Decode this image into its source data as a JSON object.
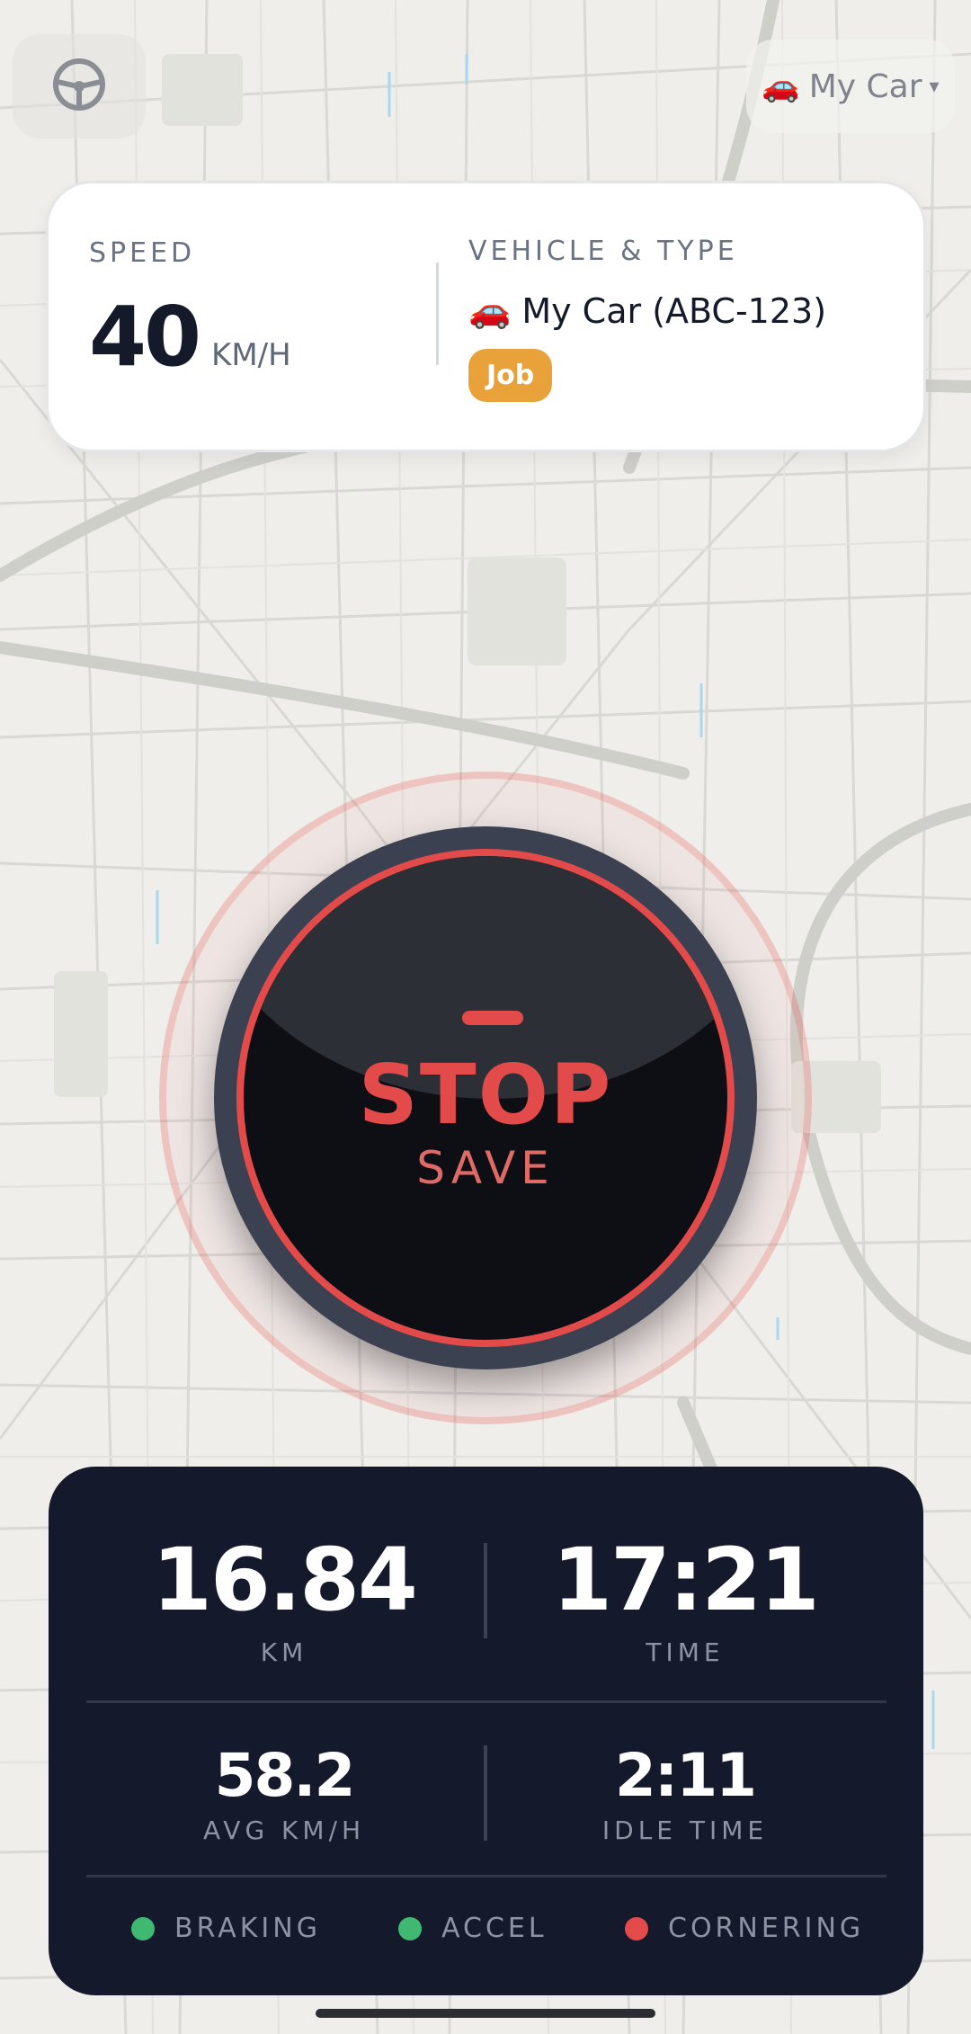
{
  "top_bar": {
    "steering_icon": "steering-wheel-icon",
    "vehicle_selector": {
      "emoji": "🚗",
      "label": "My Car",
      "caret": "▾"
    }
  },
  "info_card": {
    "speed_label": "SPEED",
    "speed_value": "40",
    "speed_unit": "KM/H",
    "vehicle_label": "VEHICLE & TYPE",
    "vehicle_emoji": "🚗",
    "vehicle_name": "My Car (ABC-123)",
    "trip_type": "Job"
  },
  "stop_button": {
    "primary": "STOP",
    "secondary": "SAVE"
  },
  "stats": {
    "distance": {
      "value": "16.84",
      "label": "KM"
    },
    "time": {
      "value": "17:21",
      "label": "TIME"
    },
    "avg_speed": {
      "value": "58.2",
      "label": "AVG KM/H"
    },
    "idle_time": {
      "value": "2:11",
      "label": "IDLE TIME"
    },
    "flags": [
      {
        "label": "BRAKING",
        "color": "#3fb871"
      },
      {
        "label": "ACCEL",
        "color": "#3fb871"
      },
      {
        "label": "CORNERING",
        "color": "#e24b4a"
      }
    ]
  },
  "colors": {
    "accent_red": "#e24b4a",
    "job_badge": "#e9a23a",
    "panel_dark": "#141a2b",
    "map_bg": "#efeeea"
  }
}
